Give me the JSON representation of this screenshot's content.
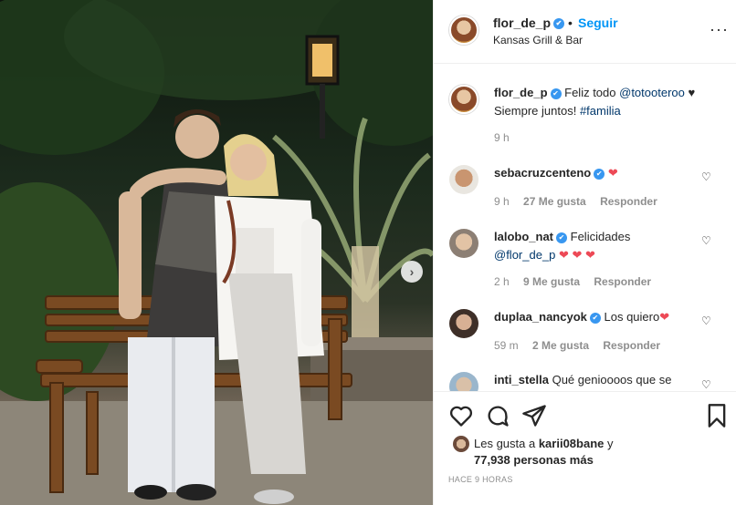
{
  "post": {
    "username": "flor_de_p",
    "follow_label": "Seguir",
    "dot": "•",
    "location": "Kansas Grill & Bar",
    "more": "···"
  },
  "caption": {
    "username": "flor_de_p",
    "text_before": "Feliz todo ",
    "mention": "@totooteroo",
    "heart": "♥",
    "line2": "Siempre juntos! ",
    "hashtag": "#familia",
    "time": "9 h"
  },
  "comments": [
    {
      "username": "sebacruzcenteno",
      "text": "",
      "hearts": "❤",
      "time": "9 h",
      "likes": "27 Me gusta",
      "reply": "Responder"
    },
    {
      "username": "lalobo_nat",
      "text": "Felicidades",
      "mention": "@flor_de_p",
      "hearts": "❤ ❤ ❤",
      "time": "2 h",
      "likes": "9 Me gusta",
      "reply": "Responder"
    },
    {
      "username": "duplaa_nancyok",
      "text": "Los quiero",
      "hearts": "❤",
      "time": "59 m",
      "likes": "2 Me gusta",
      "reply": "Responder"
    },
    {
      "username": "inti_stella",
      "text": "Qué genioooos que se"
    }
  ],
  "likes": {
    "prefix": "Les gusta a ",
    "user": "karii08bane",
    "middle": " y",
    "count": "77,938 personas más"
  },
  "timestamp": "HACE 9 HORAS",
  "colors": {
    "accent": "#0095f6",
    "verified": "#3897f0",
    "heart": "#ed4956"
  }
}
